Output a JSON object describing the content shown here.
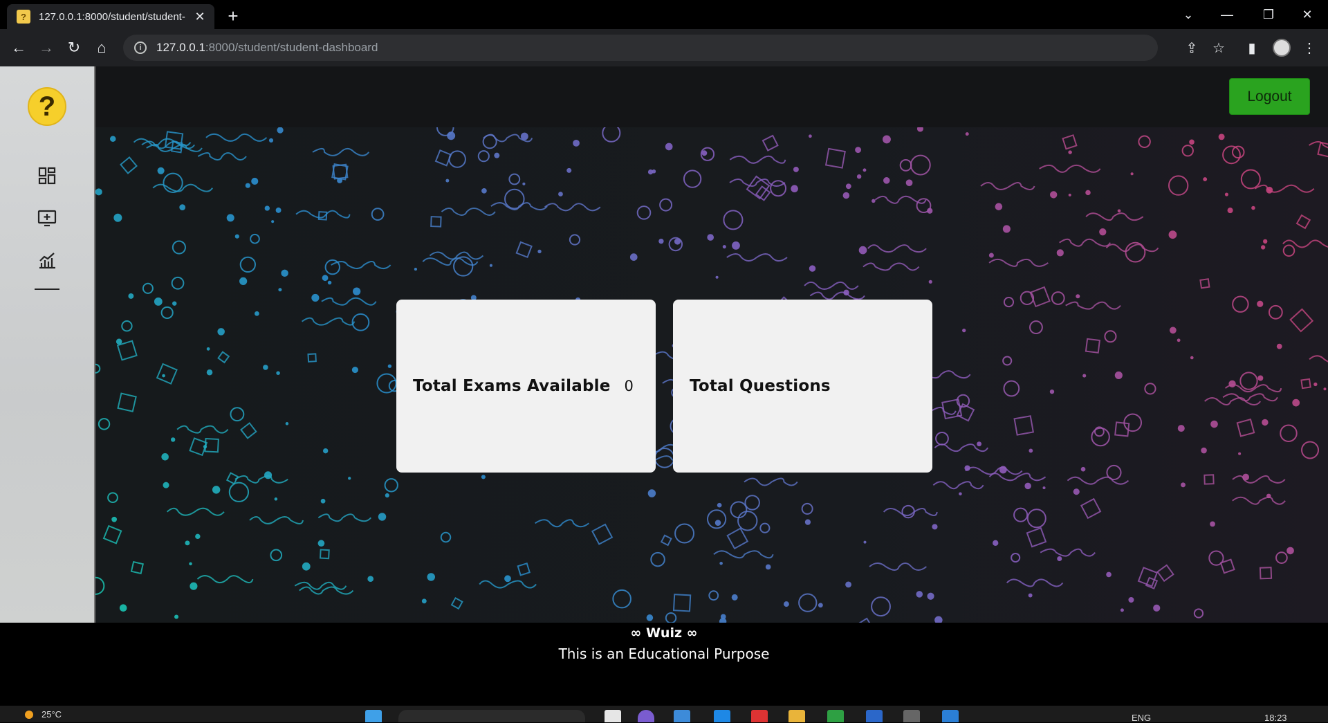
{
  "browser": {
    "tab_title": "127.0.0.1:8000/student/student-",
    "favicon_glyph": "?",
    "url_host": "127.0.0.1",
    "url_path": ":8000/student/student-dashboard"
  },
  "header": {
    "logout_label": "Logout"
  },
  "sidebar": {
    "logo_glyph": "?",
    "items": [
      {
        "icon": "dashboard-icon"
      },
      {
        "icon": "add-exam-icon"
      },
      {
        "icon": "stats-chart-icon"
      }
    ]
  },
  "cards": [
    {
      "label": "Total Exams Available",
      "value": "0"
    },
    {
      "label": "Total Questions",
      "value": ""
    }
  ],
  "footer": {
    "brand": "∞ Wuiz ∞",
    "tagline": "This is an Educational Purpose"
  },
  "taskbar": {
    "temperature": "25°C",
    "language": "ENG",
    "time": "18:23"
  },
  "colors": {
    "logout_bg": "#2aa31f",
    "card_bg": "#f1f1f1",
    "doodle_teal": "#19c9b0",
    "doodle_blue": "#2a8fd0",
    "doodle_purple": "#8a5fc2",
    "doodle_pink": "#c8457f"
  }
}
